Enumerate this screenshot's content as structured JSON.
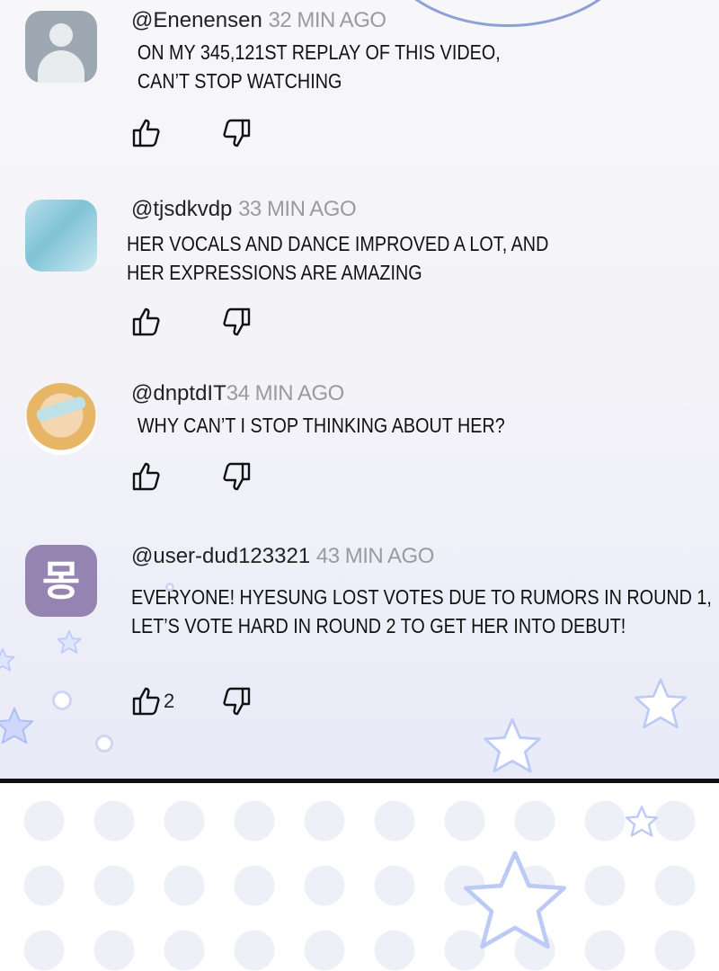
{
  "comments": [
    {
      "handle": "@Enenensen",
      "time": "32 MIN AGO",
      "lines": [
        "ON MY 345,121ST REPLAY OF THIS VIDEO,",
        "CAN’T STOP WATCHING"
      ],
      "likes": "",
      "avatar": "default-avatar"
    },
    {
      "handle": "@tjsdkvdp",
      "time": "33 MIN AGO",
      "lines": [
        "HER VOCALS AND DANCE IMPROVED A LOT, AND",
        "HER EXPRESSIONS ARE AMAZING"
      ],
      "likes": "",
      "avatar": "water-avatar"
    },
    {
      "handle": "@dnptdIT",
      "time": "34 MIN AGO",
      "lines": [
        "WHY CAN’T I STOP THINKING ABOUT HER?"
      ],
      "likes": "",
      "avatar": "anime-avatar"
    },
    {
      "handle": "@user-dud123321",
      "time": "43 MIN AGO",
      "lines": [
        "EVERYONE! HYESUNG LOST VOTES DUE TO RUMORS IN ROUND 1,",
        "LET’S VOTE HARD IN ROUND 2 TO GET HER INTO DEBUT!"
      ],
      "likes": "2",
      "avatar": "몽"
    }
  ],
  "colors": {
    "text": "#111111",
    "time": "#9a9aa0",
    "avatar_purple": "#9583b2",
    "star": "#bccaf5"
  },
  "icons": {
    "like": "thumbs-up-icon",
    "dislike": "thumbs-down-icon",
    "decor": "star-icon"
  }
}
